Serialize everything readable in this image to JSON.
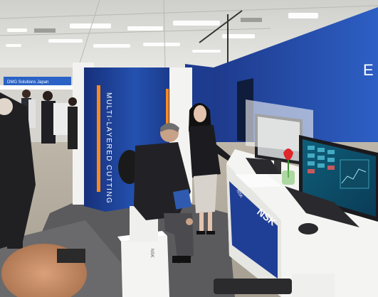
{
  "image": {
    "kind": "photograph",
    "subject": "trade show booth"
  },
  "signage": {
    "pillar_text": "MULTI-LAYERED CUTTING",
    "back_banner_text": "DMG Solutions Japan",
    "wall_letter": "E",
    "counter_logo": "NSK",
    "counter_side_text": "NSK",
    "cube_logo": "NSK"
  },
  "colors": {
    "booth_blue": "#1f3f96",
    "deep_blue": "#14266b",
    "ceiling": "#d9d8d4",
    "floor_gray": "#5b5b5e",
    "carpet_dark": "#2b2b2e",
    "white_furniture": "#f2f2f0",
    "accent_orange": "#ff8a1c",
    "tulip_red": "#e0252b"
  }
}
